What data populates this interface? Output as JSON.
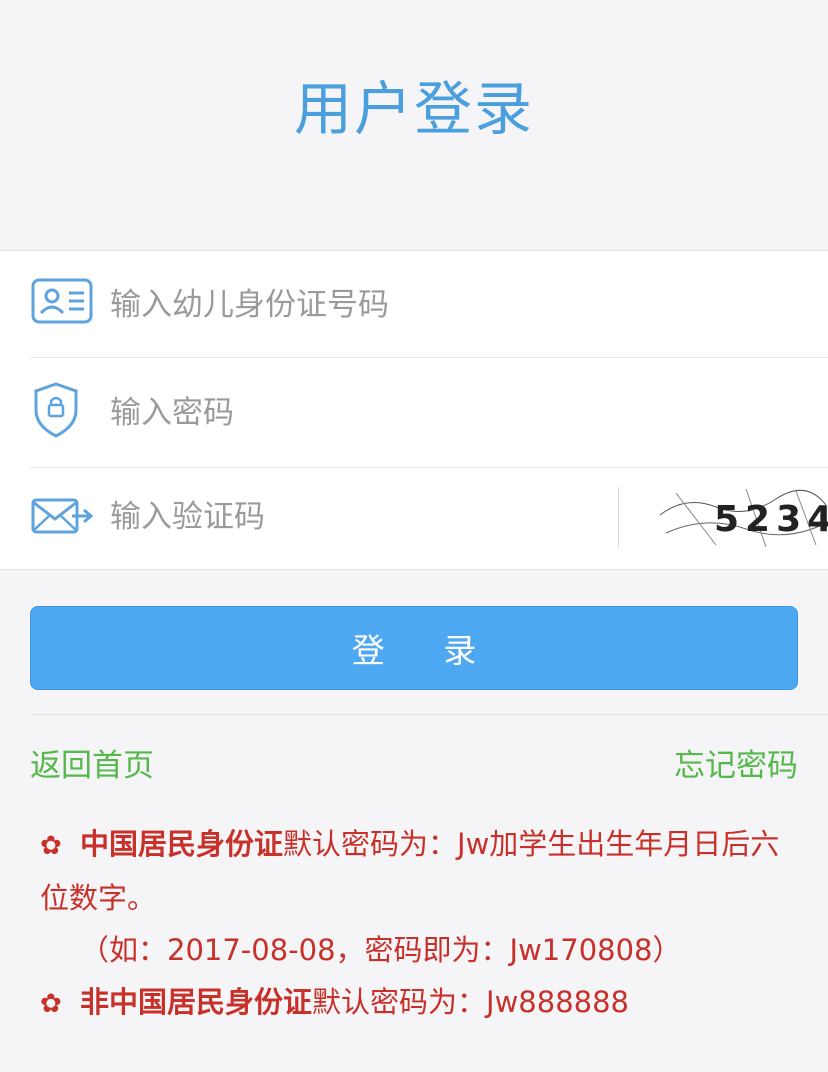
{
  "title": "用户登录",
  "form": {
    "id_placeholder": "输入幼儿身份证号码",
    "password_placeholder": "输入密码",
    "captcha_placeholder": "输入验证码",
    "captcha_text": "5234"
  },
  "login_label": "登 录",
  "links": {
    "home": "返回首页",
    "forgot": "忘记密码"
  },
  "notes": {
    "bullet_icon": "flower-icon",
    "n1_bold": "中国居民身份证",
    "n1_text": "默认密码为：Jw加学生出生年月日后六位数字。",
    "n1_example": "（如：2017-08-08，密码即为：Jw170808）",
    "n2_bold": "非中国居民身份证",
    "n2_text": "默认密码为：Jw888888"
  },
  "colors": {
    "accent": "#4a9fdc",
    "button": "#4ea8f1",
    "link": "#55b84a",
    "note": "#c8312a"
  }
}
